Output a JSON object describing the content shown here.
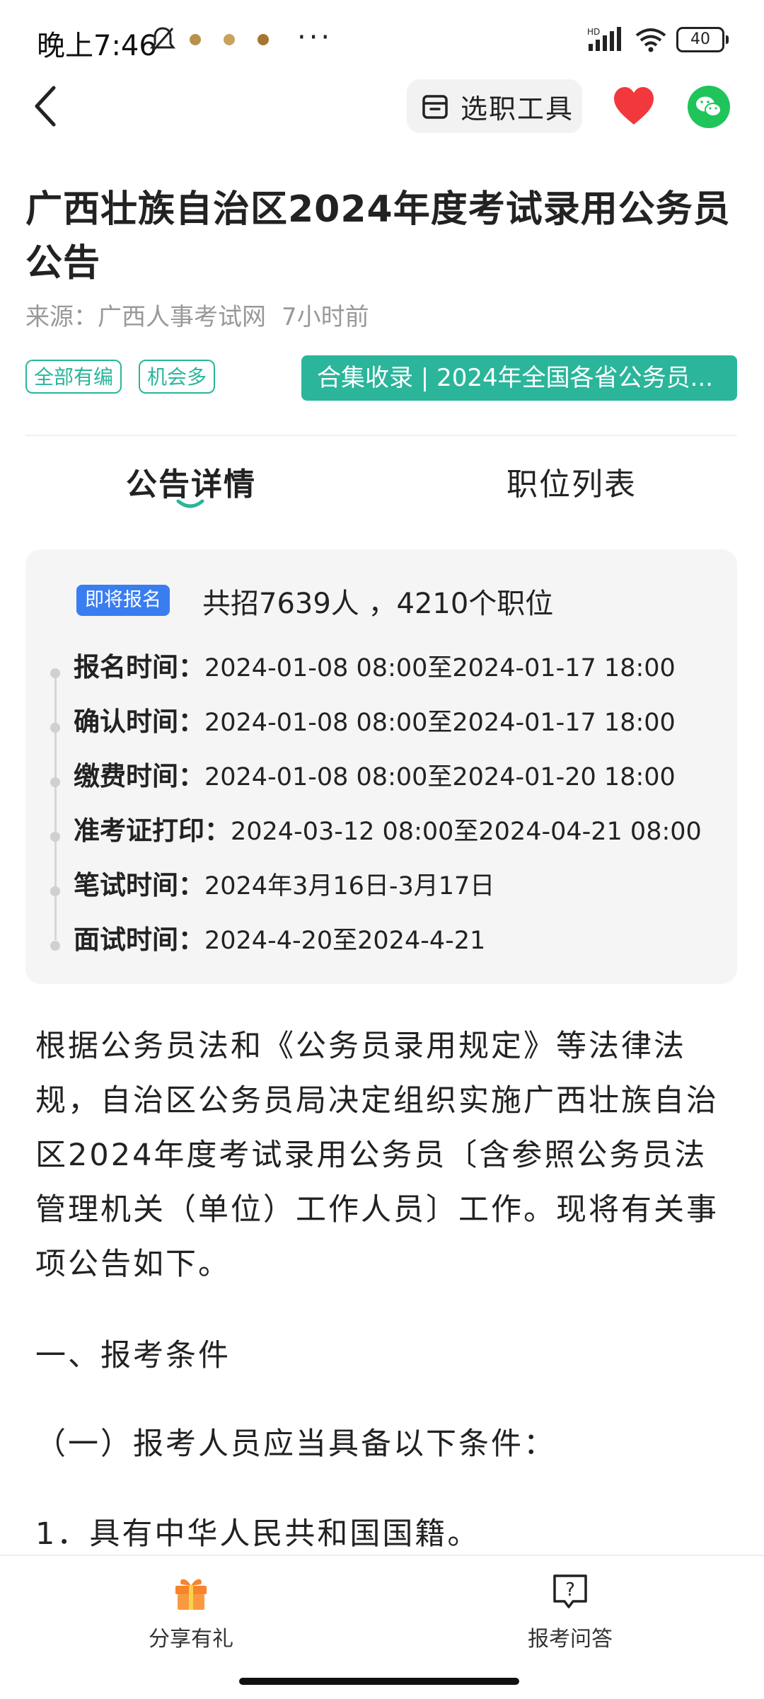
{
  "status_bar": {
    "time": "晚上7:46",
    "battery": "40",
    "network_label": "HD"
  },
  "nav": {
    "tool_label": "选职工具"
  },
  "article": {
    "title": "广西壮族自治区2024年度考试录用公务员公告",
    "source": "来源：广西人事考试网",
    "time_ago": "7小时前",
    "tags": [
      "全部有编",
      "机会多"
    ],
    "banner": "合集收录 | 2024年全国各省公务员..."
  },
  "tabs": {
    "details": "公告详情",
    "positions": "职位列表"
  },
  "card": {
    "badge": "即将报名",
    "summary": "共招7639人 ，4210个职位",
    "rows": [
      {
        "label": "报名时间：",
        "value": "2024-01-08 08:00至2024-01-17 18:00"
      },
      {
        "label": "确认时间：",
        "value": "2024-01-08 08:00至2024-01-17 18:00"
      },
      {
        "label": "缴费时间：",
        "value": "2024-01-08 08:00至2024-01-20 18:00"
      },
      {
        "label": "准考证打印：",
        "value": "2024-03-12 08:00至2024-04-21 08:00"
      },
      {
        "label": "笔试时间：",
        "value": "2024年3月16日-3月17日"
      },
      {
        "label": "面试时间：",
        "value": "2024-4-20至2024-4-21"
      }
    ]
  },
  "body": {
    "paragraph": "根据公务员法和《公务员录用规定》等法律法规，自治区公务员局决定组织实施广西壮族自治区2024年度考试录用公务员〔含参照公务员法管理机关（单位）工作人员〕工作。现将有关事项公告如下。",
    "heading1": "一、报考条件",
    "heading2": "（一）报考人员应当具备以下条件：",
    "item1": "1．具有中华人民共和国国籍。"
  },
  "bottom_bar": {
    "share": "分享有礼",
    "qa": "报考问答"
  },
  "colors": {
    "accent_green": "#2bb59b",
    "badge_blue": "#3a7df0",
    "heart_red": "#f2383c",
    "wechat_green": "#1fc45a",
    "gift_orange": "#f7842b"
  }
}
